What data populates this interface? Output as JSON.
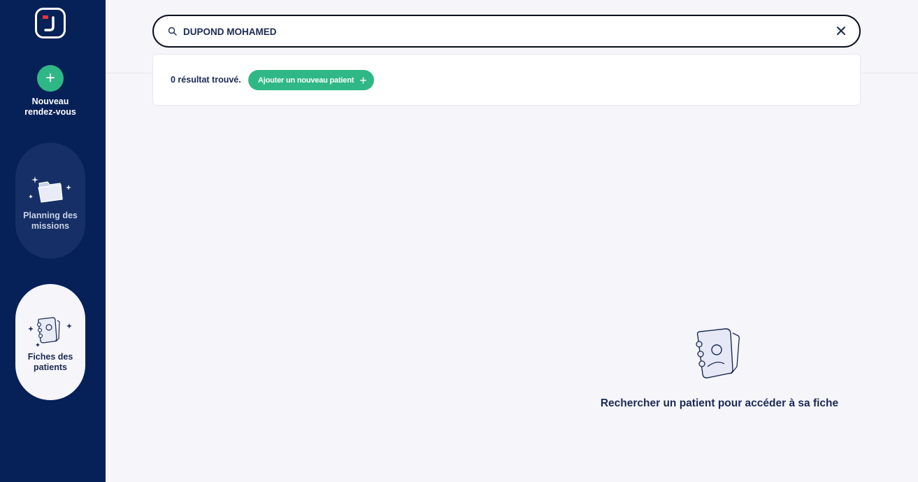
{
  "sidebar": {
    "new_appointment": {
      "icon": "plus-icon",
      "label": "Nouveau\nrendez-vous"
    },
    "items": [
      {
        "label": "Planning des\nmissions",
        "icon": "folder-icon",
        "active": false
      },
      {
        "label": "Fiches des\npatients",
        "icon": "patient-file-icon",
        "active": true
      }
    ]
  },
  "search": {
    "value": "DUPOND MOHAMED",
    "placeholder": ""
  },
  "results": {
    "count_text": "0 résultat trouvé.",
    "add_patient_label": "Ajouter un nouveau patient",
    "add_patient_icon": "plus-icon"
  },
  "empty_state": {
    "text": "Rechercher un patient pour accéder à sa fiche"
  },
  "colors": {
    "sidebar": "#062058",
    "accent_green": "#2fb886",
    "background": "#f5f5fa",
    "text_dark": "#1b2a55",
    "logo_red": "#e8333a"
  }
}
